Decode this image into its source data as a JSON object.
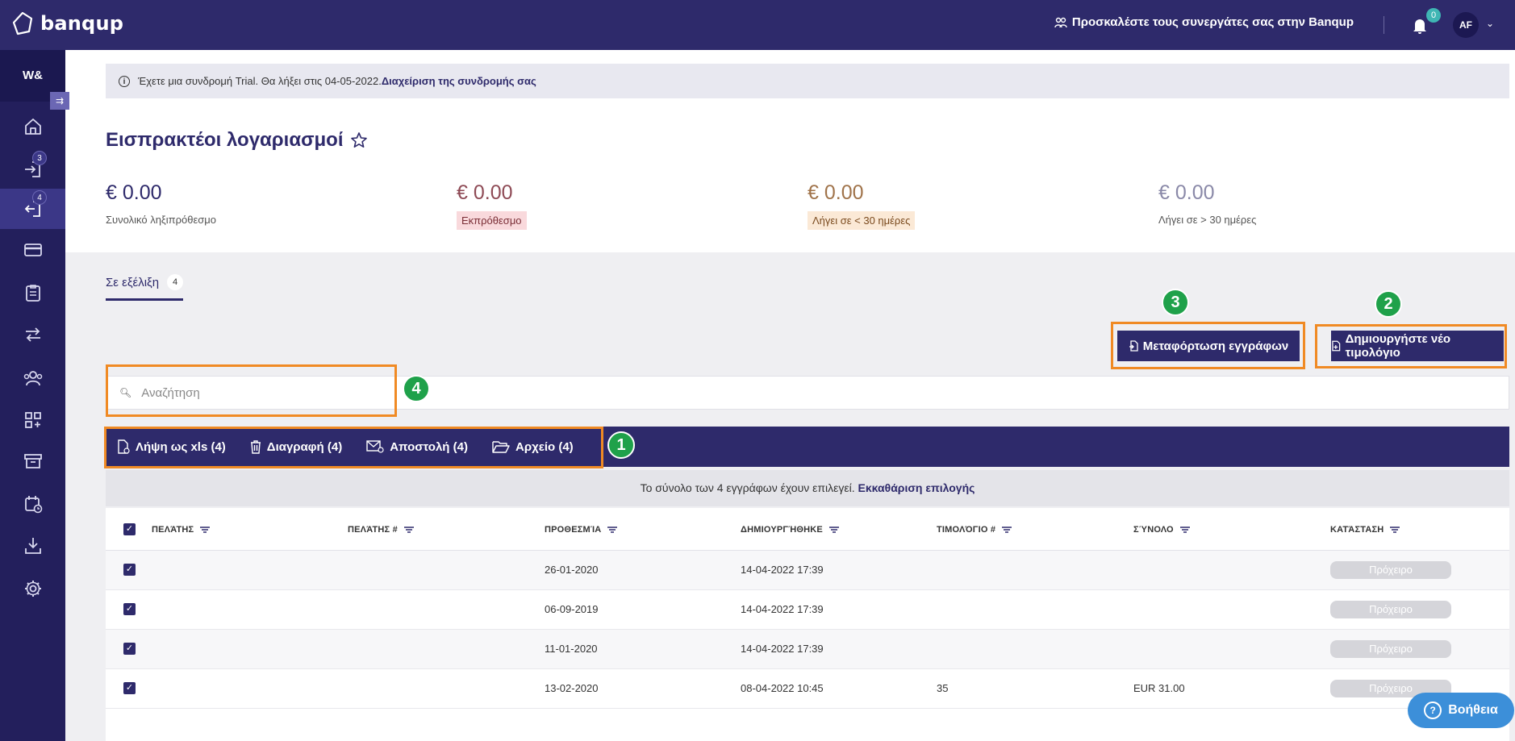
{
  "brand": {
    "name": "banqup"
  },
  "topbar": {
    "invite": "Προσκαλέστε τους συνεργάτες σας στην Banqup",
    "notifications": "0",
    "avatar": "AF"
  },
  "sidebar": {
    "org": "W&",
    "badges": {
      "incoming": "3",
      "outgoing": "4"
    }
  },
  "trial": {
    "text": "Έχετε μια συνδρομή Trial. Θα λήξει στις 04-05-2022.",
    "link": "Διαχείριση της συνδρομής σας"
  },
  "page": {
    "title": "Εισπρακτέοι λογαριασμοί"
  },
  "stats": [
    {
      "amount": "€ 0.00",
      "label": "Συνολικό ληξιπρόθεσμο",
      "color": "#2e2a6b"
    },
    {
      "amount": "€ 0.00",
      "label": "Εκπρόθεσμο",
      "color": "#8e4a55"
    },
    {
      "amount": "€ 0.00",
      "label": "Λήγει σε < 30 ημέρες",
      "color": "#a0734a"
    },
    {
      "amount": "€ 0.00",
      "label": "Λήγει σε > 30 ημέρες",
      "color": "#8a89a8"
    }
  ],
  "tab": {
    "label": "Σε εξέλιξη",
    "count": "4"
  },
  "buttons": {
    "upload": "Μεταφόρτωση εγγράφων",
    "create": "Δημιουργήστε νέο τιμολόγιο"
  },
  "markers": {
    "one": "1",
    "two": "2",
    "three": "3",
    "four": "4"
  },
  "search": {
    "placeholder": "Αναζήτηση"
  },
  "actions": {
    "download": "Λήψη ως xls (4)",
    "delete": "Διαγραφή (4)",
    "send": "Αποστολή (4)",
    "archive": "Αρχείο (4)"
  },
  "selection": {
    "text": "Το σύνολο των 4 εγγράφων έχουν επιλεγεί.",
    "clear": "Εκκαθάριση επιλογής"
  },
  "table": {
    "headers": [
      "ΠΕΛΆΤΗΣ",
      "ΠΕΛΆΤΗΣ #",
      "ΠΡΟΘΕΣΜΊΑ",
      "ΔΗΜΙΟΥΡΓΉΘΗΚΕ",
      "ΤΙΜΟΛΌΓΙΟ #",
      "ΣΎΝΟΛΟ",
      "ΚΑΤΆΣΤΑΣΗ"
    ],
    "rows": [
      {
        "customer": "",
        "customer_no": "",
        "due": "26-01-2020",
        "created": "14-04-2022 17:39",
        "invoice": "",
        "total": "",
        "status": "Πρόχειρο"
      },
      {
        "customer": "",
        "customer_no": "",
        "due": "06-09-2019",
        "created": "14-04-2022 17:39",
        "invoice": "",
        "total": "",
        "status": "Πρόχειρο"
      },
      {
        "customer": "",
        "customer_no": "",
        "due": "11-01-2020",
        "created": "14-04-2022 17:39",
        "invoice": "",
        "total": "",
        "status": "Πρόχειρο"
      },
      {
        "customer": "",
        "customer_no": "",
        "due": "13-02-2020",
        "created": "08-04-2022 10:45",
        "invoice": "35",
        "total": "EUR 31.00",
        "status": "Πρόχειρο"
      }
    ]
  },
  "help": {
    "label": "Βοήθεια"
  }
}
